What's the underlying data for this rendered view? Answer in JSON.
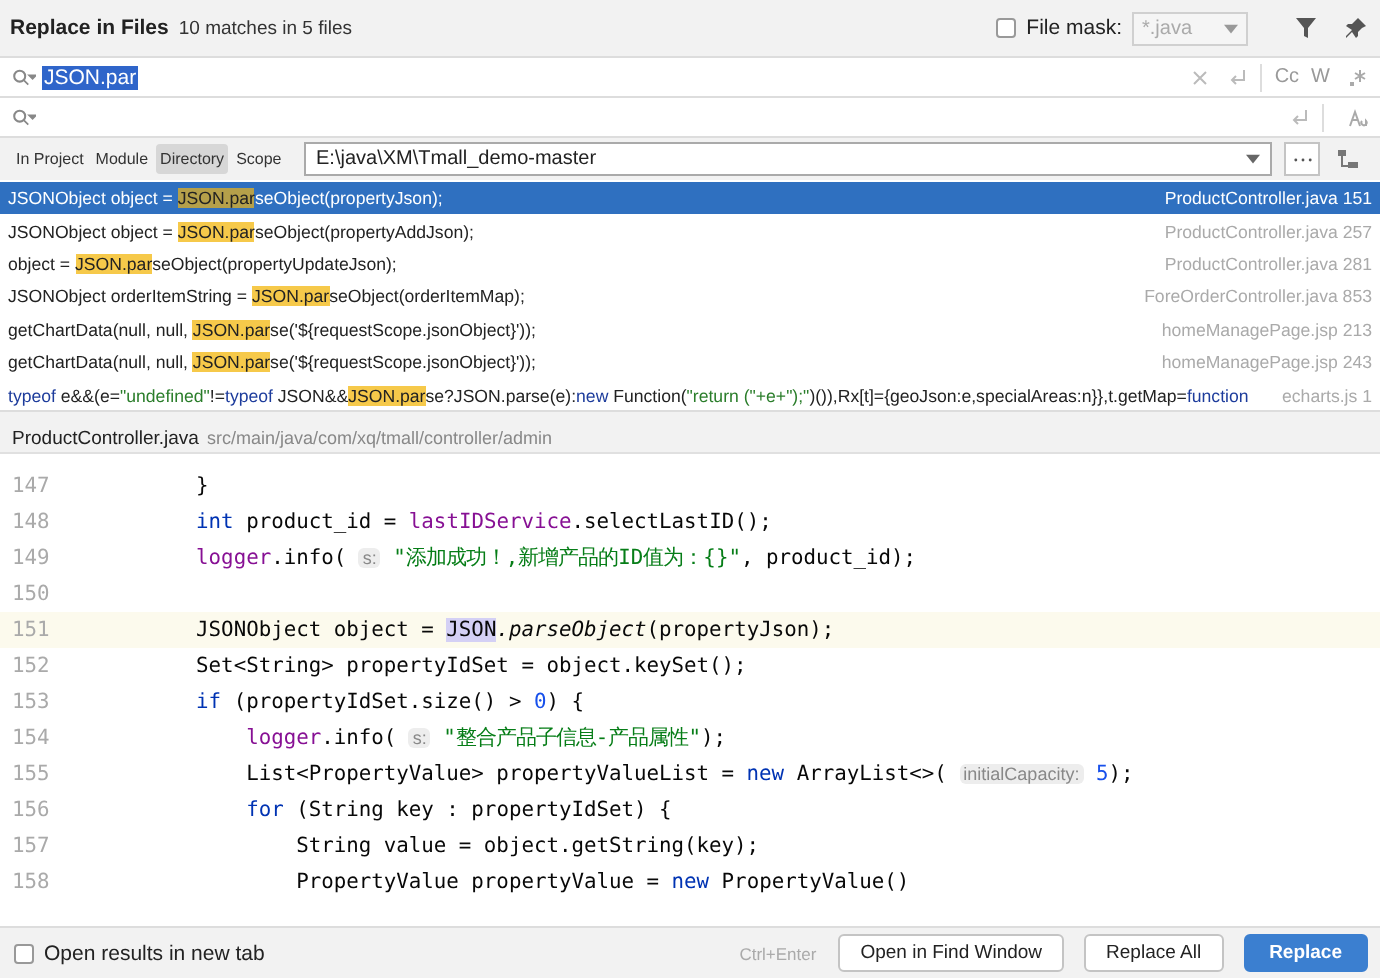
{
  "header": {
    "title": "Replace in Files",
    "summary": "10 matches in 5 files",
    "file_mask": {
      "label": "File mask:",
      "checked": false,
      "value": "*.java"
    }
  },
  "search": {
    "value": "JSON.par",
    "toggles": [
      "Cc",
      "W"
    ]
  },
  "scopes": [
    {
      "label": "In Project",
      "selected": false
    },
    {
      "label": "Module",
      "selected": false
    },
    {
      "label": "Directory",
      "selected": true
    },
    {
      "label": "Scope",
      "selected": false
    }
  ],
  "directory": "E:\\java\\XM\\Tmall_demo-master",
  "results": [
    {
      "selected": true,
      "file": "ProductController.java 151",
      "segments": [
        {
          "kind": "text",
          "text": "JSONObject object = "
        },
        {
          "kind": "match",
          "text": "JSON.par"
        },
        {
          "kind": "text",
          "text": "seObject(propertyJson);"
        }
      ]
    },
    {
      "selected": false,
      "file": "ProductController.java 257",
      "segments": [
        {
          "kind": "text",
          "text": "JSONObject object = "
        },
        {
          "kind": "match",
          "text": "JSON.par"
        },
        {
          "kind": "text",
          "text": "seObject(propertyAddJson);"
        }
      ]
    },
    {
      "selected": false,
      "file": "ProductController.java 281",
      "segments": [
        {
          "kind": "text",
          "text": "object = "
        },
        {
          "kind": "match",
          "text": "JSON.par"
        },
        {
          "kind": "text",
          "text": "seObject(propertyUpdateJson);"
        }
      ]
    },
    {
      "selected": false,
      "file": "ForeOrderController.java 853",
      "segments": [
        {
          "kind": "text",
          "text": "JSONObject orderItemString = "
        },
        {
          "kind": "match",
          "text": "JSON.par"
        },
        {
          "kind": "text",
          "text": "seObject(orderItemMap);"
        }
      ]
    },
    {
      "selected": false,
      "file": "homeManagePage.jsp 213",
      "segments": [
        {
          "kind": "text",
          "text": "getChartData(null, null, "
        },
        {
          "kind": "match",
          "text": "JSON.par"
        },
        {
          "kind": "text",
          "text": "se('${requestScope.jsonObject}'));"
        }
      ]
    },
    {
      "selected": false,
      "file": "homeManagePage.jsp 243",
      "segments": [
        {
          "kind": "text",
          "text": "getChartData(null, null, "
        },
        {
          "kind": "match",
          "text": "JSON.par"
        },
        {
          "kind": "text",
          "text": "se('${requestScope.jsonObject}'));"
        }
      ]
    },
    {
      "selected": false,
      "file": "echarts.js 1",
      "segments": [
        {
          "kind": "kw",
          "text": "typeof"
        },
        {
          "kind": "text",
          "text": " e&&(e="
        },
        {
          "kind": "str",
          "text": "\"undefined\""
        },
        {
          "kind": "text",
          "text": "!="
        },
        {
          "kind": "kw",
          "text": "typeof"
        },
        {
          "kind": "text",
          "text": " JSON&&"
        },
        {
          "kind": "match",
          "text": "JSON.par"
        },
        {
          "kind": "text",
          "text": "se?JSON.parse(e):"
        },
        {
          "kind": "kw",
          "text": "new"
        },
        {
          "kind": "text",
          "text": " Function("
        },
        {
          "kind": "str",
          "text": "\"return (\"+e+\");\""
        },
        {
          "kind": "text",
          "text": ")()),Rx[t]={geoJson:e,specialAreas:n}},t.getMap="
        },
        {
          "kind": "kw",
          "text": "function"
        }
      ]
    }
  ],
  "preview": {
    "file": "ProductController.java",
    "path": "src/main/java/com/xq/tmall/controller/admin"
  },
  "code": [
    {
      "number": "147",
      "current": false,
      "tokens": [
        {
          "kind": "text",
          "text": "        }"
        }
      ]
    },
    {
      "number": "148",
      "current": false,
      "tokens": [
        {
          "kind": "kw",
          "text": "        int"
        },
        {
          "kind": "text",
          "text": " product_id = "
        },
        {
          "kind": "field",
          "text": "lastIDService"
        },
        {
          "kind": "text",
          "text": ".selectLastID();"
        }
      ]
    },
    {
      "number": "149",
      "current": false,
      "tokens": [
        {
          "kind": "field",
          "text": "        logger"
        },
        {
          "kind": "text",
          "text": ".info( "
        },
        {
          "kind": "hint",
          "text": "s:"
        },
        {
          "kind": "str",
          "text": " \"添加成功！,新增产品的ID值为：{}\""
        },
        {
          "kind": "text",
          "text": ", product_id);"
        }
      ]
    },
    {
      "number": "150",
      "current": false
    },
    {
      "number": "151",
      "current": true,
      "tokens": [
        {
          "kind": "text",
          "text": "        JSONObject object = "
        },
        {
          "kind": "match",
          "text": "JSON"
        },
        {
          "kind": "italic",
          "text": ".parseObject"
        },
        {
          "kind": "text",
          "text": "(propertyJson);"
        }
      ]
    },
    {
      "number": "152",
      "current": false,
      "tokens": [
        {
          "kind": "text",
          "text": "        Set<String> propertyIdSet = object.keySet();"
        }
      ]
    },
    {
      "number": "153",
      "current": false,
      "tokens": [
        {
          "kind": "kw",
          "text": "        if"
        },
        {
          "kind": "text",
          "text": " (propertyIdSet.size() > "
        },
        {
          "kind": "num",
          "text": "0"
        },
        {
          "kind": "text",
          "text": ") {"
        }
      ]
    },
    {
      "number": "154",
      "current": false,
      "tokens": [
        {
          "kind": "field",
          "text": "            logger"
        },
        {
          "kind": "text",
          "text": ".info( "
        },
        {
          "kind": "hint",
          "text": "s:"
        },
        {
          "kind": "str",
          "text": " \"整合产品子信息-产品属性\""
        },
        {
          "kind": "text",
          "text": ");"
        }
      ]
    },
    {
      "number": "155",
      "current": false,
      "tokens": [
        {
          "kind": "text",
          "text": "            List<PropertyValue> propertyValueList = "
        },
        {
          "kind": "kw",
          "text": "new"
        },
        {
          "kind": "text",
          "text": " ArrayList<>( "
        },
        {
          "kind": "hint",
          "text": "initialCapacity:"
        },
        {
          "kind": "num",
          "text": " 5"
        },
        {
          "kind": "text",
          "text": ");"
        }
      ]
    },
    {
      "number": "156",
      "current": false,
      "tokens": [
        {
          "kind": "kw",
          "text": "            for"
        },
        {
          "kind": "text",
          "text": " (String key : propertyIdSet) {"
        }
      ]
    },
    {
      "number": "157",
      "current": false,
      "tokens": [
        {
          "kind": "text",
          "text": "                String value = object.getString(key);"
        }
      ]
    },
    {
      "number": "158",
      "current": false,
      "tokens": [
        {
          "kind": "text",
          "text": "                PropertyValue propertyValue = "
        },
        {
          "kind": "kw",
          "text": "new"
        },
        {
          "kind": "text",
          "text": " PropertyValue()"
        }
      ]
    }
  ],
  "footer": {
    "new_tab": {
      "label": "Open results in new tab",
      "checked": false
    },
    "shortcut": "Ctrl+Enter",
    "buttons": [
      {
        "label": "Open in Find Window",
        "kind": "default"
      },
      {
        "label": "Replace All",
        "kind": "default"
      },
      {
        "label": "Replace",
        "kind": "primary"
      }
    ]
  }
}
